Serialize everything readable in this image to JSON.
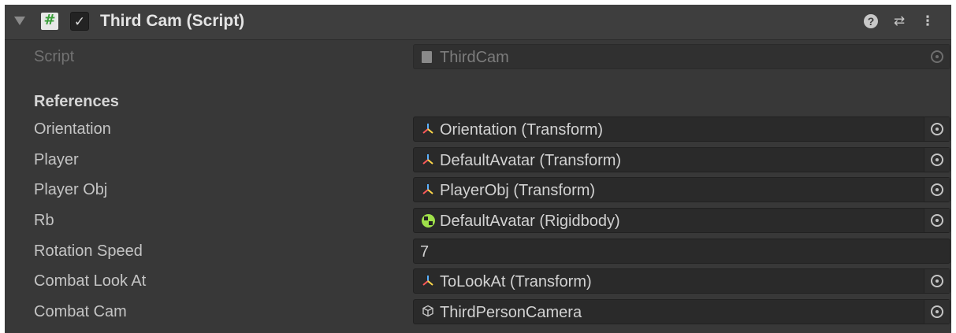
{
  "component": {
    "title": "Third Cam (Script)",
    "enabled": true,
    "icons": {
      "foldout": "foldout-triangle-icon",
      "script": "csharp-script-icon",
      "help": "help-icon",
      "presets": "presets-icon",
      "menu": "context-menu-icon"
    }
  },
  "script_row": {
    "label": "Script",
    "value": "ThirdCam"
  },
  "section": {
    "label": "References"
  },
  "fields": [
    {
      "label": "Orientation",
      "value": "Orientation (Transform)",
      "icon": "transform-icon"
    },
    {
      "label": "Player",
      "value": "DefaultAvatar (Transform)",
      "icon": "transform-icon"
    },
    {
      "label": "Player Obj",
      "value": "PlayerObj (Transform)",
      "icon": "transform-icon"
    },
    {
      "label": "Rb",
      "value": "DefaultAvatar (Rigidbody)",
      "icon": "rigidbody-icon"
    },
    {
      "label": "Rotation Speed",
      "value": "7"
    },
    {
      "label": "Combat Look At",
      "value": "ToLookAt (Transform)",
      "icon": "transform-icon"
    },
    {
      "label": "Combat Cam",
      "value": "ThirdPersonCamera",
      "icon": "gameobject-icon"
    }
  ],
  "colors": {
    "panel_bg": "#383838",
    "field_bg": "#2a2a2a",
    "rigidbody_icon": "#9fe04a"
  }
}
